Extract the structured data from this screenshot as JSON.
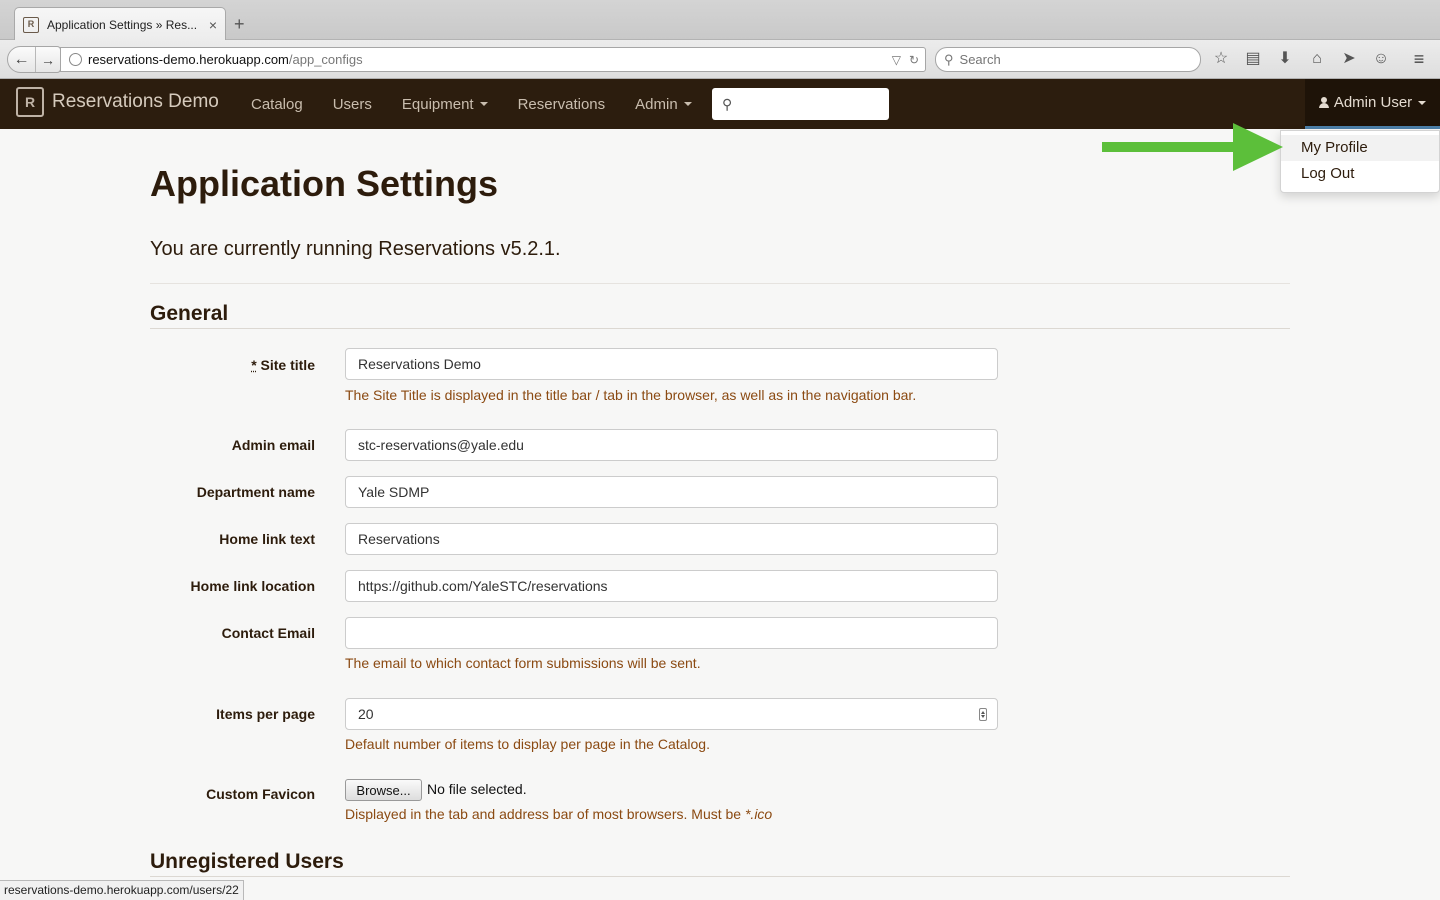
{
  "browser": {
    "tab_title": "Application Settings » Res...",
    "new_tab": "+",
    "url_host": "reservations-demo.herokuapp.com",
    "url_path": "/app_configs",
    "search_placeholder": "Search",
    "status_url": "reservations-demo.herokuapp.com/users/22"
  },
  "navbar": {
    "brand": "Reservations Demo",
    "links": {
      "catalog": "Catalog",
      "users": "Users",
      "equipment": "Equipment",
      "reservations": "Reservations",
      "admin": "Admin"
    },
    "user": "Admin User",
    "dropdown": {
      "my_profile": "My Profile",
      "log_out": "Log Out"
    }
  },
  "page": {
    "title": "Application Settings",
    "version_text": "You are currently running Reservations v5.2.1.",
    "section_general": "General",
    "section_unregistered": "Unregistered Users"
  },
  "form": {
    "site_title": {
      "required_mark": "*",
      "label": "Site title",
      "value": "Reservations Demo",
      "help": "The Site Title is displayed in the title bar / tab in the browser, as well as in the navigation bar."
    },
    "admin_email": {
      "label": "Admin email",
      "value": "stc-reservations@yale.edu"
    },
    "department_name": {
      "label": "Department name",
      "value": "Yale SDMP"
    },
    "home_link_text": {
      "label": "Home link text",
      "value": "Reservations"
    },
    "home_link_location": {
      "label": "Home link location",
      "value": "https://github.com/YaleSTC/reservations"
    },
    "contact_email": {
      "label": "Contact Email",
      "value": "",
      "help": "The email to which contact form submissions will be sent."
    },
    "items_per_page": {
      "label": "Items per page",
      "value": "20",
      "help": "Default number of items to display per page in the Catalog."
    },
    "custom_favicon": {
      "label": "Custom Favicon",
      "browse": "Browse...",
      "file_status": "No file selected.",
      "help_prefix": "Displayed in the tab and address bar of most browsers. Must be ",
      "help_ext": "*.ico"
    }
  },
  "colors": {
    "navbar_bg": "#2c1d0e",
    "help_text": "#8b4a12",
    "annotation_arrow": "#5cbf3a"
  }
}
